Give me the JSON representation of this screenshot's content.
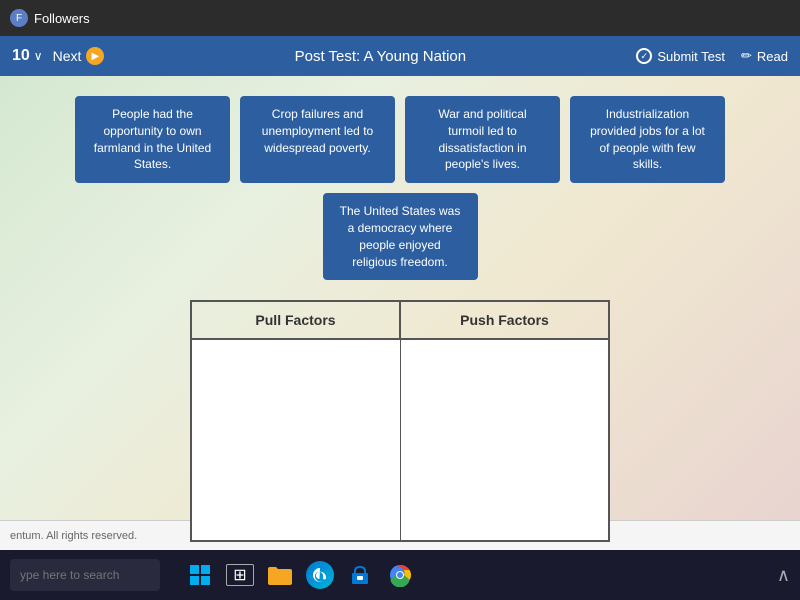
{
  "titlebar": {
    "label": "Followers"
  },
  "navbar": {
    "question_num": "10",
    "chevron": "∨",
    "next_label": "Next",
    "page_title": "Post Test: A Young Nation",
    "submit_label": "Submit Test",
    "read_label": "Read"
  },
  "cards": [
    {
      "id": "card1",
      "text": "People had the opportunity to own farmland in the United States."
    },
    {
      "id": "card2",
      "text": "Crop failures and unemployment led to widespread poverty."
    },
    {
      "id": "card3",
      "text": "War and political turmoil led to dissatisfaction in people's lives."
    },
    {
      "id": "card4",
      "text": "Industrialization provided jobs for a lot of people with few skills."
    },
    {
      "id": "card5",
      "text": "The United States was a democracy where people enjoyed religious freedom."
    }
  ],
  "table": {
    "col1_header": "Pull Factors",
    "col2_header": "Push Factors"
  },
  "footer": {
    "text": "entum. All rights reserved."
  },
  "taskbar": {
    "search_placeholder": "ype here to search"
  }
}
